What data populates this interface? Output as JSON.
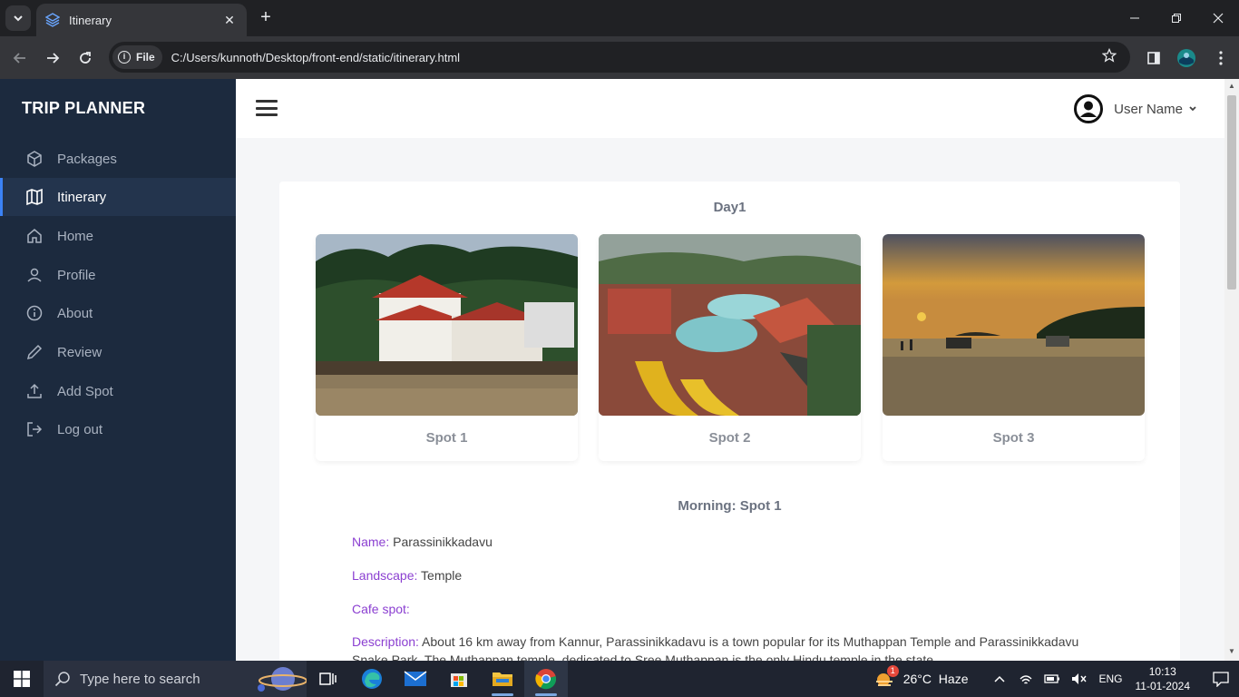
{
  "browser": {
    "tab_title": "Itinerary",
    "new_tab": "+",
    "security_chip": "File",
    "url": "C:/Users/kunnoth/Desktop/front-end/static/itinerary.html"
  },
  "sidebar": {
    "brand": "TRIP PLANNER",
    "items": [
      {
        "label": "Packages",
        "icon": "package-icon"
      },
      {
        "label": "Itinerary",
        "icon": "map-icon",
        "active": true
      },
      {
        "label": "Home",
        "icon": "home-icon"
      },
      {
        "label": "Profile",
        "icon": "user-icon"
      },
      {
        "label": "About",
        "icon": "info-icon"
      },
      {
        "label": "Review",
        "icon": "pencil-icon"
      },
      {
        "label": "Add Spot",
        "icon": "upload-icon"
      },
      {
        "label": "Log out",
        "icon": "logout-icon"
      }
    ]
  },
  "topbar": {
    "user_name": "User Name"
  },
  "itinerary": {
    "day_title": "Day1",
    "spots": [
      {
        "label": "Spot 1"
      },
      {
        "label": "Spot 2"
      },
      {
        "label": "Spot 3"
      }
    ],
    "session_title": "Morning: Spot 1",
    "fields": {
      "name_key": "Name:",
      "name_value": "Parassinikkadavu",
      "landscape_key": "Landscape:",
      "landscape_value": "Temple",
      "cafe_key": "Cafe spot:",
      "cafe_value": "",
      "description_key": "Description:",
      "description_value": "About 16 km away from Kannur, Parassinikkadavu is a town popular for its Muthappan Temple and Parassinikkadavu Snake Park. The Muthappan temple, dedicated to Sree Muthappan is the only Hindu temple in the state"
    }
  },
  "taskbar": {
    "search_placeholder": "Type here to search",
    "weather_badge": "1",
    "weather": "26°C  Haze",
    "language": "ENG",
    "time": "10:13",
    "date": "11-01-2024"
  },
  "colors": {
    "sidebar_bg": "#1c2a3e",
    "active_accent": "#3b82f6",
    "field_key": "#8b3fd1"
  }
}
